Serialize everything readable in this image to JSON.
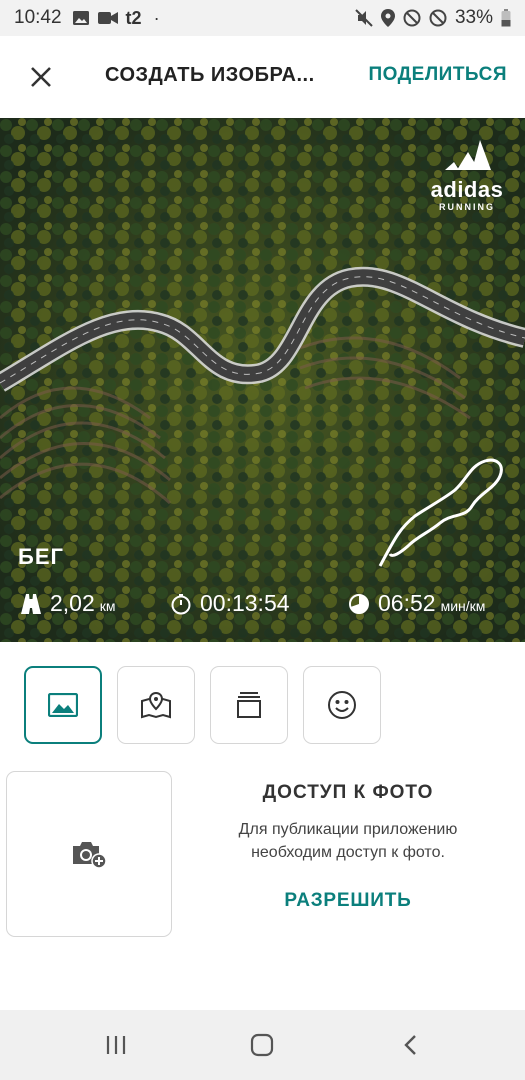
{
  "status_bar": {
    "time": "10:42",
    "carrier": "t2",
    "battery": "33%",
    "icons": [
      "image-icon",
      "video-icon",
      "carrier-icon",
      "dot-icon",
      "mute-icon",
      "location-icon",
      "block-icon",
      "block-icon",
      "battery-icon"
    ]
  },
  "toolbar": {
    "close_icon": "close-icon",
    "title": "СОЗДАТЬ ИЗОБРА...",
    "share_label": "ПОДЕЛИТЬСЯ"
  },
  "hero": {
    "brand_name": "adidas",
    "brand_sub": "RUNNING",
    "activity": "БЕГ",
    "stats": [
      {
        "icon": "road-icon",
        "value": "2,02",
        "unit": "км"
      },
      {
        "icon": "stopwatch-icon",
        "value": "00:13:54",
        "unit": ""
      },
      {
        "icon": "pace-icon",
        "value": "06:52",
        "unit": "мин/км"
      }
    ]
  },
  "tabs": [
    {
      "icon": "image-icon",
      "active": true
    },
    {
      "icon": "map-icon",
      "active": false
    },
    {
      "icon": "layers-icon",
      "active": false
    },
    {
      "icon": "smiley-icon",
      "active": false
    }
  ],
  "photo_access": {
    "camera_icon": "camera-add-icon",
    "heading": "ДОСТУП К ФОТО",
    "description_line1": "Для публикации приложению",
    "description_line2": "необходим доступ к фото.",
    "allow_label": "РАЗРЕШИТЬ"
  },
  "nav_bar": {
    "buttons": [
      "recents-icon",
      "home-icon",
      "back-icon"
    ]
  },
  "colors": {
    "accent": "#0b7f7c",
    "border": "#d6d6d6",
    "status_bg": "#f2f2f2"
  }
}
